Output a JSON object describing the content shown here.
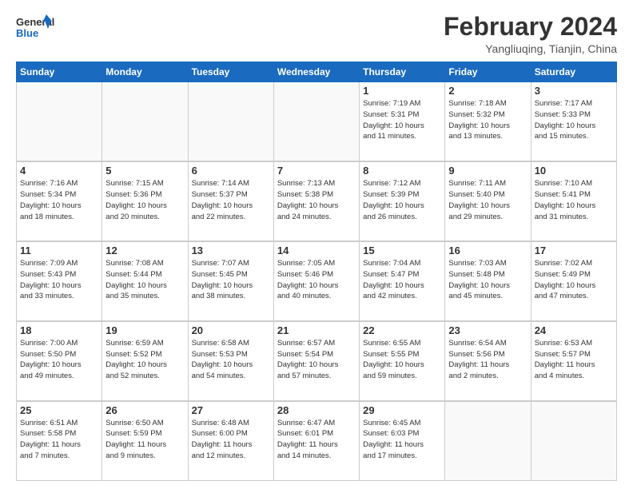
{
  "logo": {
    "line1": "General",
    "line2": "Blue"
  },
  "title": "February 2024",
  "location": "Yangliuqing, Tianjin, China",
  "headers": [
    "Sunday",
    "Monday",
    "Tuesday",
    "Wednesday",
    "Thursday",
    "Friday",
    "Saturday"
  ],
  "weeks": [
    [
      {
        "day": "",
        "info": ""
      },
      {
        "day": "",
        "info": ""
      },
      {
        "day": "",
        "info": ""
      },
      {
        "day": "",
        "info": ""
      },
      {
        "day": "1",
        "info": "Sunrise: 7:19 AM\nSunset: 5:31 PM\nDaylight: 10 hours\nand 11 minutes."
      },
      {
        "day": "2",
        "info": "Sunrise: 7:18 AM\nSunset: 5:32 PM\nDaylight: 10 hours\nand 13 minutes."
      },
      {
        "day": "3",
        "info": "Sunrise: 7:17 AM\nSunset: 5:33 PM\nDaylight: 10 hours\nand 15 minutes."
      }
    ],
    [
      {
        "day": "4",
        "info": "Sunrise: 7:16 AM\nSunset: 5:34 PM\nDaylight: 10 hours\nand 18 minutes."
      },
      {
        "day": "5",
        "info": "Sunrise: 7:15 AM\nSunset: 5:36 PM\nDaylight: 10 hours\nand 20 minutes."
      },
      {
        "day": "6",
        "info": "Sunrise: 7:14 AM\nSunset: 5:37 PM\nDaylight: 10 hours\nand 22 minutes."
      },
      {
        "day": "7",
        "info": "Sunrise: 7:13 AM\nSunset: 5:38 PM\nDaylight: 10 hours\nand 24 minutes."
      },
      {
        "day": "8",
        "info": "Sunrise: 7:12 AM\nSunset: 5:39 PM\nDaylight: 10 hours\nand 26 minutes."
      },
      {
        "day": "9",
        "info": "Sunrise: 7:11 AM\nSunset: 5:40 PM\nDaylight: 10 hours\nand 29 minutes."
      },
      {
        "day": "10",
        "info": "Sunrise: 7:10 AM\nSunset: 5:41 PM\nDaylight: 10 hours\nand 31 minutes."
      }
    ],
    [
      {
        "day": "11",
        "info": "Sunrise: 7:09 AM\nSunset: 5:43 PM\nDaylight: 10 hours\nand 33 minutes."
      },
      {
        "day": "12",
        "info": "Sunrise: 7:08 AM\nSunset: 5:44 PM\nDaylight: 10 hours\nand 35 minutes."
      },
      {
        "day": "13",
        "info": "Sunrise: 7:07 AM\nSunset: 5:45 PM\nDaylight: 10 hours\nand 38 minutes."
      },
      {
        "day": "14",
        "info": "Sunrise: 7:05 AM\nSunset: 5:46 PM\nDaylight: 10 hours\nand 40 minutes."
      },
      {
        "day": "15",
        "info": "Sunrise: 7:04 AM\nSunset: 5:47 PM\nDaylight: 10 hours\nand 42 minutes."
      },
      {
        "day": "16",
        "info": "Sunrise: 7:03 AM\nSunset: 5:48 PM\nDaylight: 10 hours\nand 45 minutes."
      },
      {
        "day": "17",
        "info": "Sunrise: 7:02 AM\nSunset: 5:49 PM\nDaylight: 10 hours\nand 47 minutes."
      }
    ],
    [
      {
        "day": "18",
        "info": "Sunrise: 7:00 AM\nSunset: 5:50 PM\nDaylight: 10 hours\nand 49 minutes."
      },
      {
        "day": "19",
        "info": "Sunrise: 6:59 AM\nSunset: 5:52 PM\nDaylight: 10 hours\nand 52 minutes."
      },
      {
        "day": "20",
        "info": "Sunrise: 6:58 AM\nSunset: 5:53 PM\nDaylight: 10 hours\nand 54 minutes."
      },
      {
        "day": "21",
        "info": "Sunrise: 6:57 AM\nSunset: 5:54 PM\nDaylight: 10 hours\nand 57 minutes."
      },
      {
        "day": "22",
        "info": "Sunrise: 6:55 AM\nSunset: 5:55 PM\nDaylight: 10 hours\nand 59 minutes."
      },
      {
        "day": "23",
        "info": "Sunrise: 6:54 AM\nSunset: 5:56 PM\nDaylight: 11 hours\nand 2 minutes."
      },
      {
        "day": "24",
        "info": "Sunrise: 6:53 AM\nSunset: 5:57 PM\nDaylight: 11 hours\nand 4 minutes."
      }
    ],
    [
      {
        "day": "25",
        "info": "Sunrise: 6:51 AM\nSunset: 5:58 PM\nDaylight: 11 hours\nand 7 minutes."
      },
      {
        "day": "26",
        "info": "Sunrise: 6:50 AM\nSunset: 5:59 PM\nDaylight: 11 hours\nand 9 minutes."
      },
      {
        "day": "27",
        "info": "Sunrise: 6:48 AM\nSunset: 6:00 PM\nDaylight: 11 hours\nand 12 minutes."
      },
      {
        "day": "28",
        "info": "Sunrise: 6:47 AM\nSunset: 6:01 PM\nDaylight: 11 hours\nand 14 minutes."
      },
      {
        "day": "29",
        "info": "Sunrise: 6:45 AM\nSunset: 6:03 PM\nDaylight: 11 hours\nand 17 minutes."
      },
      {
        "day": "",
        "info": ""
      },
      {
        "day": "",
        "info": ""
      }
    ]
  ]
}
